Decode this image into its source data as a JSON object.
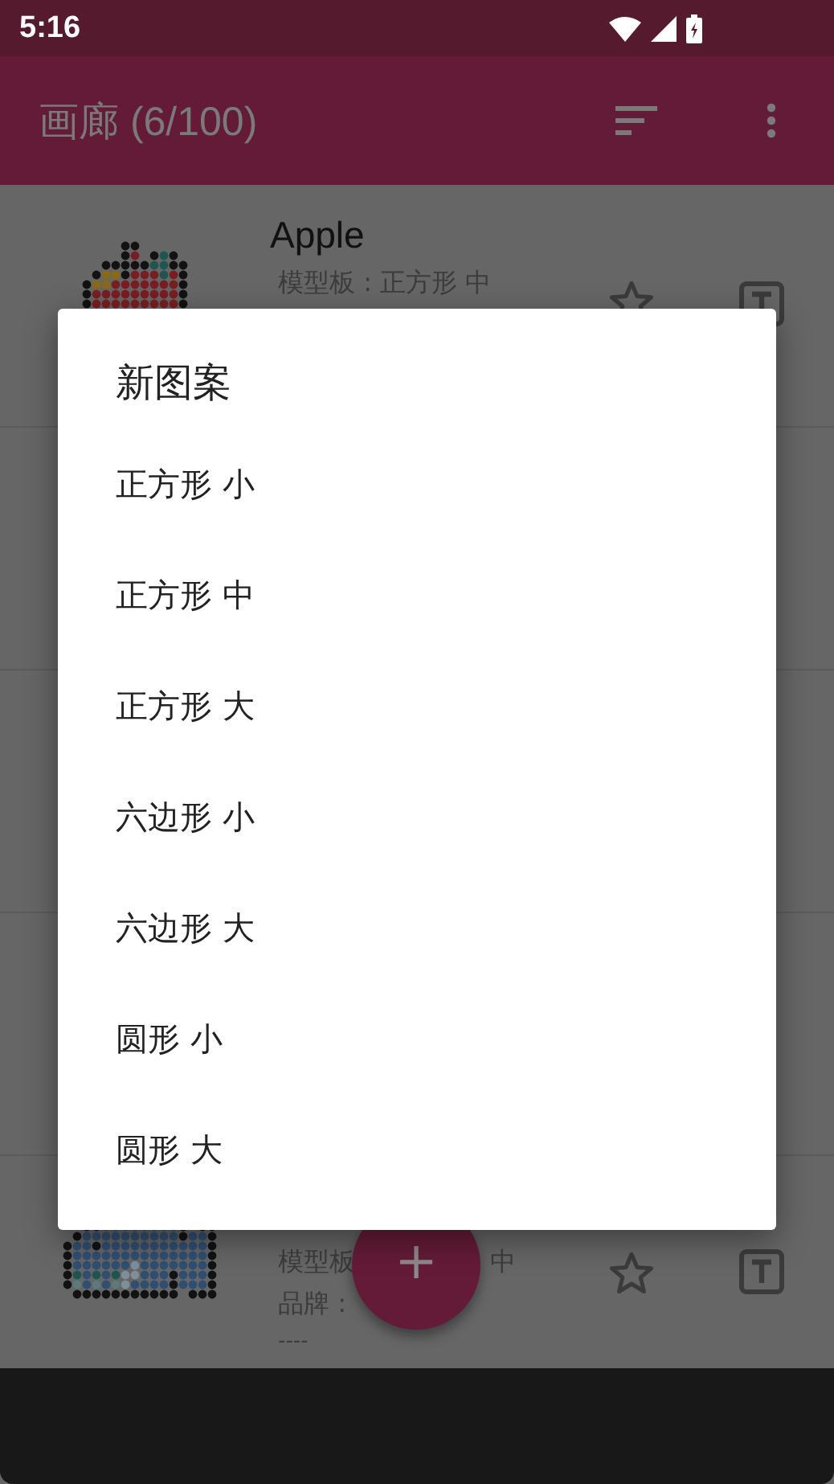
{
  "status_bar": {
    "time": "5:16"
  },
  "app_bar": {
    "title": "画廊 (6/100)"
  },
  "patterns": [
    {
      "kind": "full",
      "title": "Apple",
      "template": "模型板 : 正方形 中",
      "favorite": false
    },
    {
      "kind": "covered"
    },
    {
      "kind": "covered"
    },
    {
      "kind": "covered"
    },
    {
      "kind": "partial",
      "template_start": "模型板",
      "template_end": "中",
      "brand": "品牌 :",
      "notes": "----",
      "favorite": false
    }
  ],
  "fab": {
    "label": "+"
  },
  "dialog": {
    "title": "新图案",
    "options": [
      "正方形 小",
      "正方形 中",
      "正方形 大",
      "六边形 小",
      "六边形 大",
      "圆形 小",
      "圆形 大"
    ]
  }
}
